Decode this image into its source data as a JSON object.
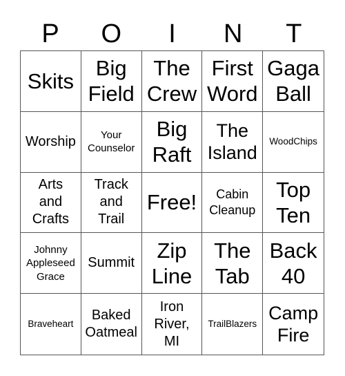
{
  "header": {
    "letters": [
      "P",
      "O",
      "I",
      "N",
      "T"
    ]
  },
  "cells": [
    "Skits",
    "Big\nField",
    "The\nCrew",
    "First\nWord",
    "Gaga\nBall",
    "Worship",
    "Your\nCounselor",
    "Big\nRaft",
    "The\nIsland",
    "WoodChips",
    "Arts\nand\nCrafts",
    "Track\nand\nTrail",
    "Free!",
    "Cabin\nCleanup",
    "Top\nTen",
    "Johnny\nAppleseed\nGrace",
    "Summit",
    "Zip\nLine",
    "The\nTab",
    "Back\n40",
    "Braveheart",
    "Baked\nOatmeal",
    "Iron\nRiver,\nMI",
    "TrailBlazers",
    "Camp\nFire"
  ],
  "colors": {
    "grid_line": "#555555",
    "text": "#000000",
    "background": "#ffffff"
  }
}
